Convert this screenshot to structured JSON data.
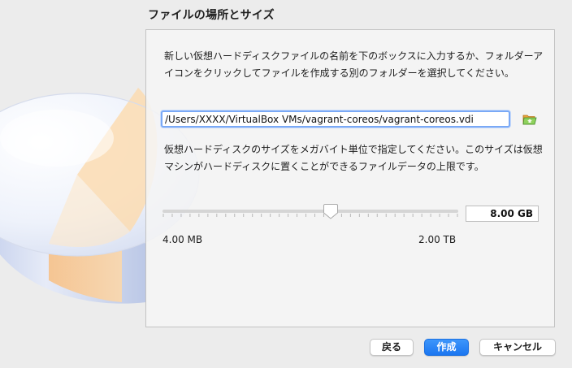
{
  "page_title": "ファイルの場所とサイズ",
  "location": {
    "description": "新しい仮想ハードディスクファイルの名前を下のボックスに入力するか、フォルダーアイコンをクリックしてファイルを作成する別のフォルダーを選択してください。",
    "path_value": "/Users/XXXX/VirtualBox VMs/vagrant-coreos/vagrant-coreos.vdi",
    "folder_icon": "folder-icon"
  },
  "size": {
    "description": "仮想ハードディスクのサイズをメガバイト単位で指定してください。このサイズは仮想マシンがハードディスクに置くことができるファイルデータの上限です。",
    "value": "8.00 GB",
    "min_label": "4.00 MB",
    "max_label": "2.00 TB",
    "slider_fraction": 0.57,
    "tick_count": 34
  },
  "buttons": {
    "back": "戻る",
    "create": "作成",
    "cancel": "キャンセル"
  },
  "colors": {
    "accent": "#1b76f0",
    "focus_ring": "#7aa9f6",
    "folder_green": "#4cae3c",
    "folder_orange": "#e9a23b"
  }
}
